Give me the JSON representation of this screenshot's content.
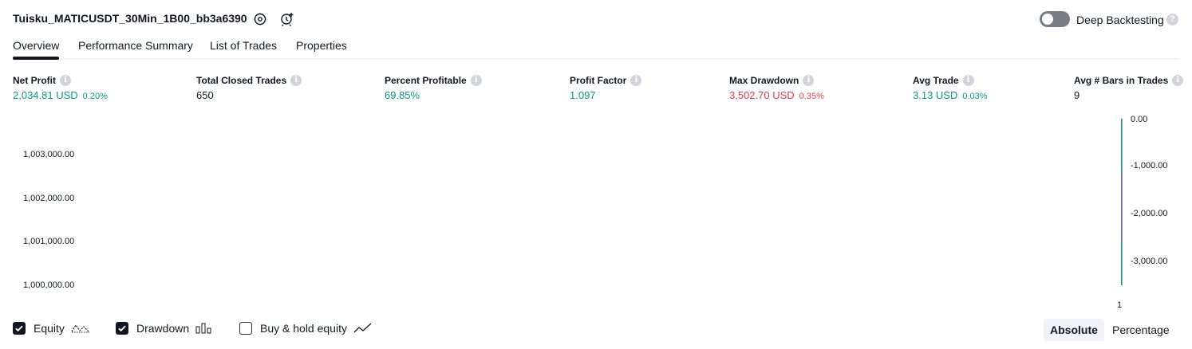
{
  "header": {
    "strategy_name": "Tuisku_MATICUSDT_30Min_1B00_bb3a6390",
    "deep_backtesting_label": "Deep Backtesting",
    "deep_backtesting_enabled": false
  },
  "tabs": [
    {
      "label": "Overview",
      "active": true
    },
    {
      "label": "Performance Summary",
      "active": false
    },
    {
      "label": "List of Trades",
      "active": false
    },
    {
      "label": "Properties",
      "active": false
    }
  ],
  "metrics": [
    {
      "label": "Net Profit",
      "value": "2,034.81 USD",
      "sub": "0.20%",
      "tone": "green"
    },
    {
      "label": "Total Closed Trades",
      "value": "650",
      "sub": "",
      "tone": "dark"
    },
    {
      "label": "Percent Profitable",
      "value": "69.85%",
      "sub": "",
      "tone": "green"
    },
    {
      "label": "Profit Factor",
      "value": "1.097",
      "sub": "",
      "tone": "green"
    },
    {
      "label": "Max Drawdown",
      "value": "3,502.70 USD",
      "sub": "0.35%",
      "tone": "red"
    },
    {
      "label": "Avg Trade",
      "value": "3.13 USD",
      "sub": "0.03%",
      "tone": "green"
    },
    {
      "label": "Avg # Bars in Trades",
      "value": "9",
      "sub": "",
      "tone": "dark"
    }
  ],
  "chart_data": {
    "type": "area",
    "left_axis_ticks": [
      "1,003,000.00",
      "1,002,000.00",
      "1,001,000.00",
      "1,000,000.00"
    ],
    "right_axis_ticks": [
      "0.00",
      "-1,000.00",
      "-2,000.00",
      "-3,000.00"
    ],
    "x_tick_labels": [
      "1"
    ],
    "series": [
      {
        "name": "Equity",
        "color": "#089981"
      },
      {
        "name": "Drawdown",
        "color": "#7e57c2"
      }
    ]
  },
  "legend": {
    "equity": {
      "label": "Equity",
      "checked": true
    },
    "drawdown": {
      "label": "Drawdown",
      "checked": true
    },
    "buy_hold": {
      "label": "Buy & hold equity",
      "checked": false
    }
  },
  "view_mode": {
    "absolute_label": "Absolute",
    "percentage_label": "Percentage",
    "selected": "Absolute"
  },
  "colors": {
    "positive": "#089981",
    "negative": "#f23645",
    "accent": "#131722"
  }
}
